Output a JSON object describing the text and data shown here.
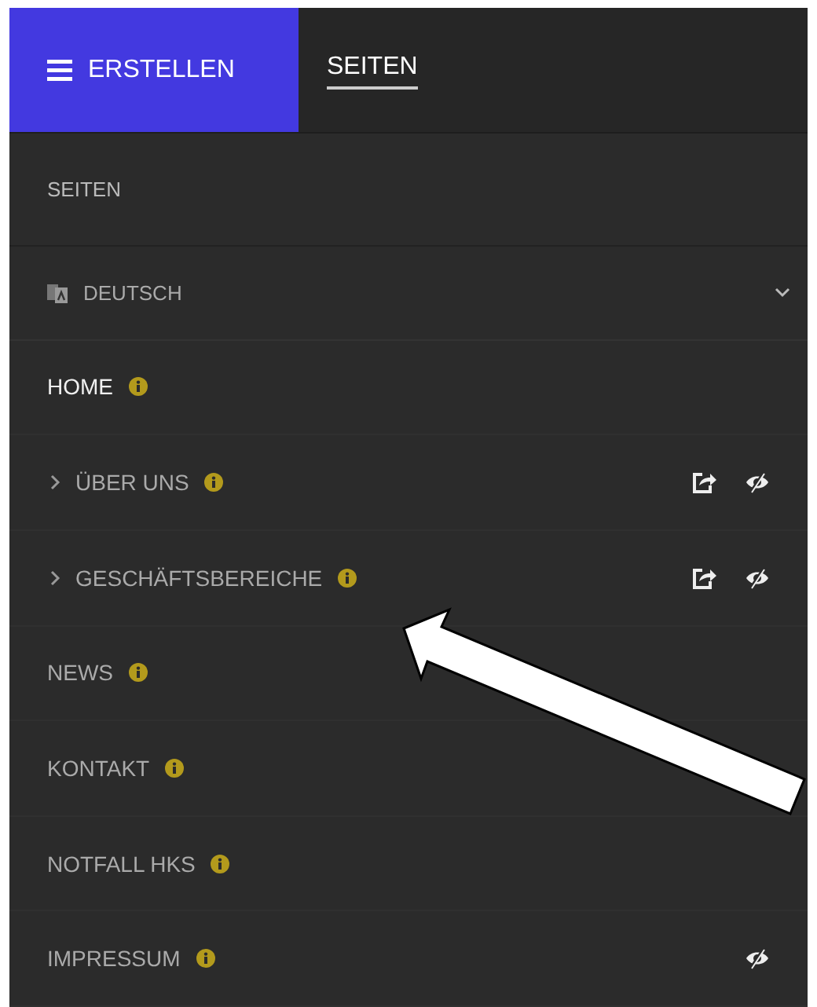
{
  "header": {
    "menu_button": "ERSTELLEN",
    "tabs": [
      {
        "label": "SEITEN",
        "selected": true
      }
    ]
  },
  "section_title": "SEITEN",
  "language": {
    "label": "DEUTSCH",
    "expanded": false
  },
  "pages": [
    {
      "label": "HOME",
      "selected": true,
      "has_children": false,
      "shared": false,
      "hidden": false
    },
    {
      "label": "ÜBER UNS",
      "selected": false,
      "has_children": true,
      "shared": true,
      "hidden": true
    },
    {
      "label": "GESCHÄFTSBEREICHE",
      "selected": false,
      "has_children": true,
      "shared": true,
      "hidden": true
    },
    {
      "label": "NEWS",
      "selected": false,
      "has_children": false,
      "shared": false,
      "hidden": false
    },
    {
      "label": "KONTAKT",
      "selected": false,
      "has_children": false,
      "shared": false,
      "hidden": false
    },
    {
      "label": "NOTFALL HKS",
      "selected": false,
      "has_children": false,
      "shared": false,
      "hidden": false
    },
    {
      "label": "IMPRESSUM",
      "selected": false,
      "has_children": false,
      "shared": false,
      "hidden": true
    }
  ]
}
